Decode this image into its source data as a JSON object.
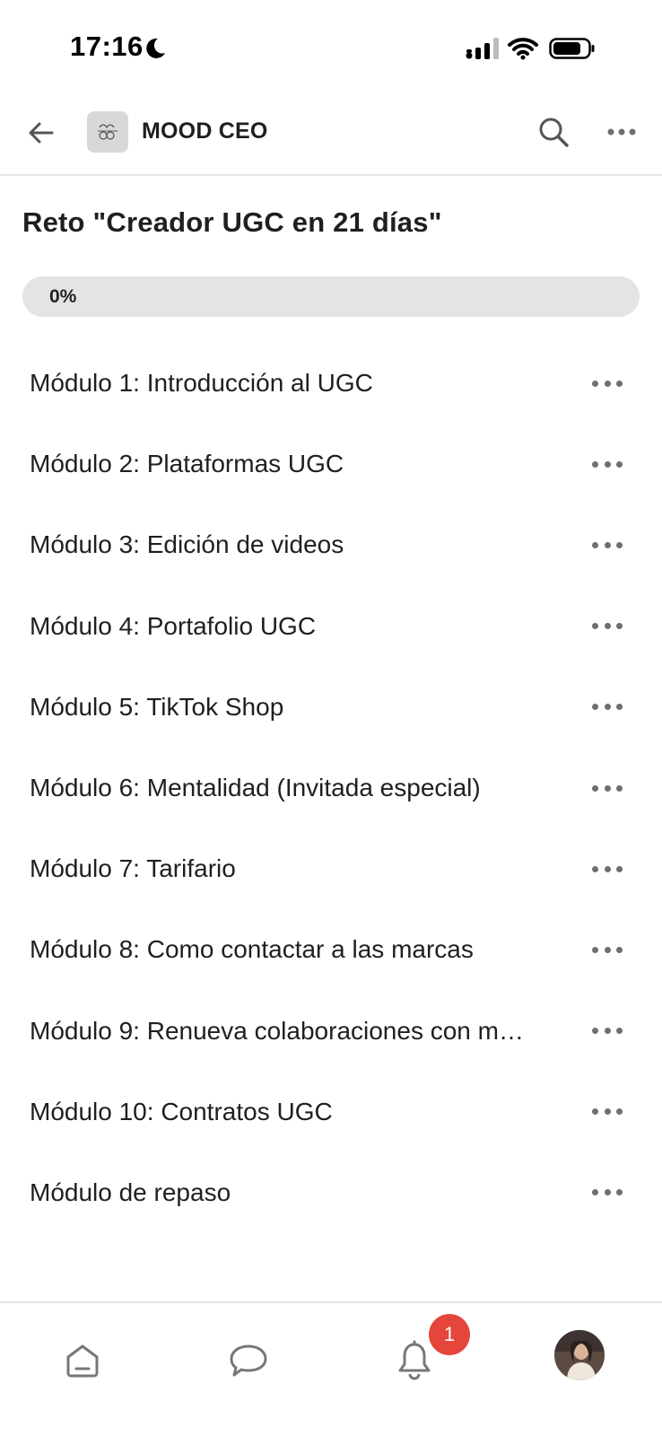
{
  "status_bar": {
    "time": "17:16",
    "icons": [
      "moon-icon",
      "signal-icon",
      "wifi-icon",
      "battery-icon"
    ]
  },
  "header": {
    "title": "MOOD CEO",
    "icons": [
      "back-arrow-icon",
      "group-logo",
      "search-icon",
      "more-options-icon"
    ]
  },
  "course": {
    "title": "Reto \"Creador UGC en 21 días\"",
    "progress_label": "0%",
    "progress_fraction": 0
  },
  "modules": [
    {
      "label": "Módulo 1: Introducción al UGC"
    },
    {
      "label": "Módulo 2: Plataformas UGC"
    },
    {
      "label": "Módulo 3: Edición de videos"
    },
    {
      "label": "Módulo 4: Portafolio UGC"
    },
    {
      "label": "Módulo 5: TikTok Shop"
    },
    {
      "label": "Módulo 6: Mentalidad (Invitada especial)"
    },
    {
      "label": "Módulo 7: Tarifario"
    },
    {
      "label": "Módulo 8: Como contactar a las marcas"
    },
    {
      "label": "Módulo 9: Renueva colaboraciones con m…"
    },
    {
      "label": "Módulo 10: Contratos UGC"
    },
    {
      "label": "Módulo de repaso"
    }
  ],
  "bottom_nav": {
    "items": [
      "home-icon",
      "chat-icon",
      "bell-icon",
      "profile-avatar"
    ],
    "notification_count": "1"
  },
  "colors": {
    "badge": "#e5463b",
    "progress_track": "#e4e4e4",
    "text": "#1f1f1f"
  }
}
